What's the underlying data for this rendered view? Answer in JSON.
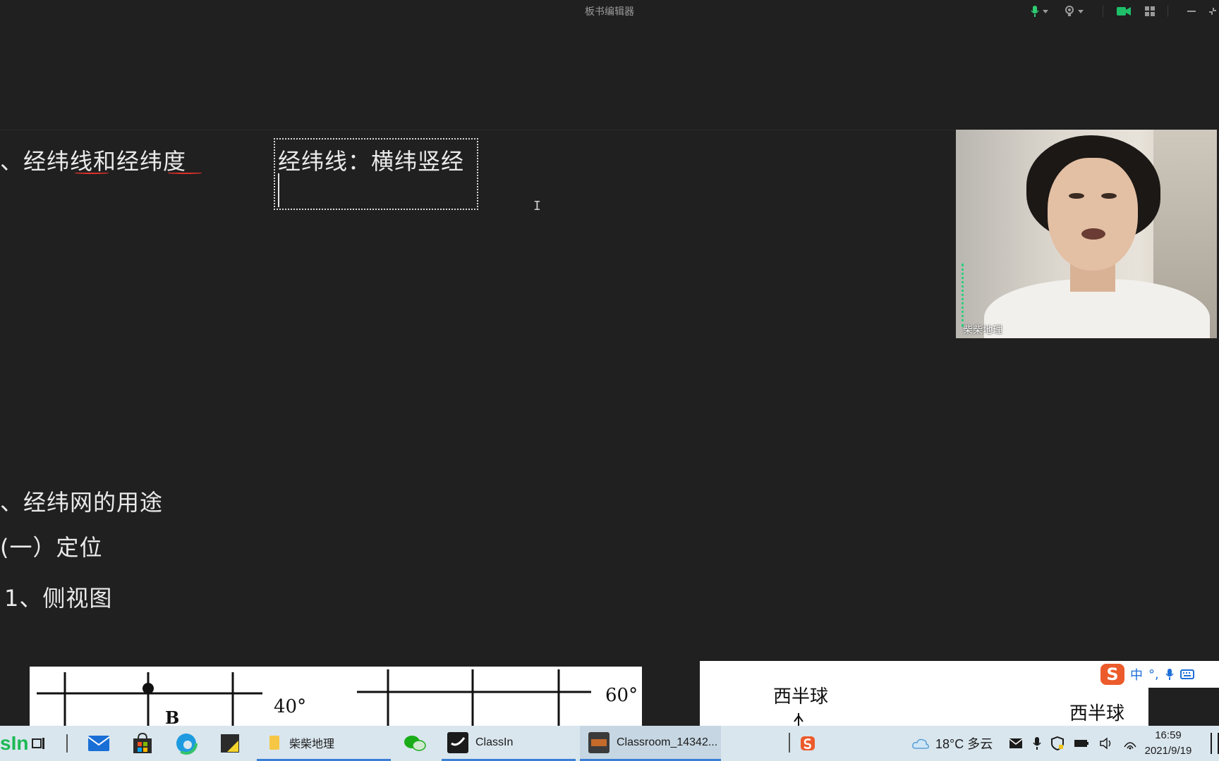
{
  "window": {
    "title": "板书编辑器"
  },
  "board": {
    "heading_1": "、经纬线和经纬度",
    "textbox_content": "经纬线：横纬竖经",
    "heading_2": "、经纬网的用途",
    "heading_3": "(一）定位",
    "heading_4": "1、侧视图"
  },
  "webcam": {
    "participant_name": "柴柴地理"
  },
  "figure_left": {
    "label_point": "B",
    "label_lat1": "40°",
    "label_lat2": "60°"
  },
  "figure_right": {
    "label_a": "西半球",
    "label_b": "西半球"
  },
  "ime": {
    "logo": "S",
    "mode": "中",
    "punct": "°,",
    "mic_icon": "mic-icon",
    "kbd_icon": "keyboard-icon"
  },
  "taskbar": {
    "classin_logo": "sIn",
    "apps": [
      {
        "label": "柴柴地理",
        "icon": "folder-icon"
      },
      {
        "label": "ClassIn",
        "icon": "classin-icon"
      },
      {
        "label": "Classroom_14342...",
        "icon": "eeo-icon"
      }
    ],
    "weather": "18°C  多云",
    "time": "16:59",
    "date": "2021/9/19"
  },
  "colors": {
    "board_bg": "#202020",
    "underline": "#e0302a",
    "taskbar_bg": "#d9e6ee",
    "accent": "#3b7fd6"
  }
}
